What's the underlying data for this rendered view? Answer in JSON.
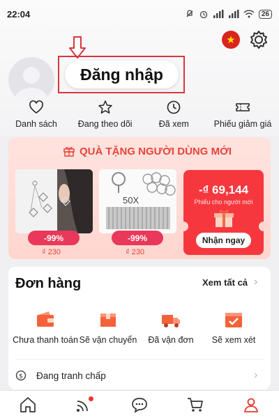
{
  "status_bar": {
    "time": "22:04",
    "battery": "26"
  },
  "header": {
    "login_label": "Đăng nhập"
  },
  "quick_links": [
    {
      "label": "Danh sách",
      "icon": "heart-icon"
    },
    {
      "label": "Đang theo dõi",
      "icon": "star-icon"
    },
    {
      "label": "Đã xem",
      "icon": "clock-icon"
    },
    {
      "label": "Phiếu giảm giá",
      "icon": "ticket-icon"
    }
  ],
  "promo": {
    "title": "QUÀ TẶNG NGƯỜI DÙNG MỚI",
    "products": [
      {
        "discount": "-99%",
        "price": "₫ 230"
      },
      {
        "discount": "-99%",
        "price": "₫ 230",
        "badge": "50X"
      }
    ],
    "voucher": {
      "amount": "-₫ 69,144",
      "subtitle": "Phiếu cho người mới",
      "button": "Nhận ngay"
    }
  },
  "orders": {
    "title": "Đơn hàng",
    "see_all": "Xem tất cả",
    "statuses": [
      {
        "label": "Chưa thanh toán",
        "icon": "wallet-icon"
      },
      {
        "label": "Sẽ vận chuyển",
        "icon": "box-icon"
      },
      {
        "label": "Đã vận đơn",
        "icon": "truck-icon"
      },
      {
        "label": "Sẽ xem xét",
        "icon": "review-icon"
      }
    ],
    "dispute": "Đang tranh chấp"
  },
  "bottom_nav": [
    {
      "icon": "home-icon"
    },
    {
      "icon": "feed-icon"
    },
    {
      "icon": "chat-icon"
    },
    {
      "icon": "cart-icon"
    },
    {
      "icon": "account-icon"
    }
  ],
  "colors": {
    "accent": "#e6443b",
    "brand_red": "#f6383e",
    "active_nav": "#e6372e"
  }
}
